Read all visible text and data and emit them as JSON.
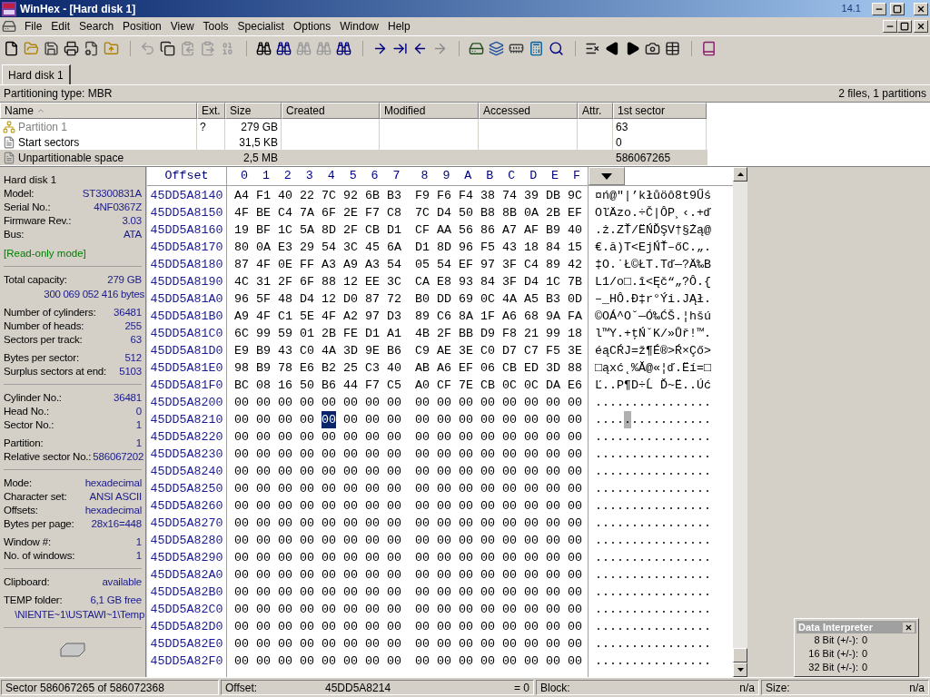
{
  "window": {
    "title": "WinHex - [Hard disk 1]",
    "version": "14.1"
  },
  "menu": [
    "File",
    "Edit",
    "Search",
    "Position",
    "View",
    "Tools",
    "Specialist",
    "Options",
    "Window",
    "Help"
  ],
  "tabs": [
    {
      "label": "Hard disk 1",
      "selected": true
    }
  ],
  "partition_bar": {
    "type": "Partitioning type: MBR",
    "summary": "2 files, 1 partitions"
  },
  "table": {
    "columns": [
      {
        "label": "Name",
        "sorted": true
      },
      {
        "label": "Ext."
      },
      {
        "label": "Size"
      },
      {
        "label": "Created"
      },
      {
        "label": "Modified"
      },
      {
        "label": "Accessed"
      },
      {
        "label": "Attr."
      },
      {
        "label": "1st sector"
      }
    ],
    "rows": [
      {
        "kind": "partition",
        "name": "Partition 1",
        "ext": "?",
        "size": "279 GB",
        "first_sector": "63",
        "selected": false
      },
      {
        "kind": "file",
        "name": "Start sectors",
        "size": "31,5 KB",
        "first_sector": "0",
        "selected": false
      },
      {
        "kind": "file",
        "name": "Unpartitionable space",
        "size": "2,5 MB",
        "first_sector": "586067265",
        "selected": true
      }
    ]
  },
  "info_panel": {
    "sections": [
      {
        "groups": [
          [
            {
              "kind": "heading",
              "label": "Hard disk 1"
            },
            {
              "kind": "pair",
              "label": "Model:",
              "value": "ST3300831A"
            },
            {
              "kind": "pair",
              "label": "Serial No.:",
              "value": "4NF0367Z"
            },
            {
              "kind": "pair",
              "label": "Firmware Rev.:",
              "value": "3.03"
            },
            {
              "kind": "pair",
              "label": "Bus:",
              "value": "ATA"
            }
          ],
          [
            {
              "kind": "note",
              "label": "[Read-only mode]"
            }
          ]
        ]
      },
      {
        "groups": [
          [
            {
              "kind": "pair",
              "label": "Total capacity:",
              "value": "279 GB"
            },
            {
              "kind": "value",
              "value": "300 069 052 416 bytes"
            }
          ],
          [
            {
              "kind": "pair",
              "label": "Number of cylinders:",
              "value": "36481"
            },
            {
              "kind": "pair",
              "label": "Number of heads:",
              "value": "255"
            },
            {
              "kind": "pair",
              "label": "Sectors per track:",
              "value": "63"
            }
          ],
          [
            {
              "kind": "pair",
              "label": "Bytes per sector:",
              "value": "512"
            },
            {
              "kind": "pair",
              "label": "Surplus sectors at end:",
              "value": "5103"
            }
          ]
        ]
      },
      {
        "groups": [
          [
            {
              "kind": "pair",
              "label": "Cylinder No.:",
              "value": "36481"
            },
            {
              "kind": "pair",
              "label": "Head No.:",
              "value": "0"
            },
            {
              "kind": "pair",
              "label": "Sector No.:",
              "value": "1"
            }
          ],
          [
            {
              "kind": "pair",
              "label": "Partition:",
              "value": "1"
            },
            {
              "kind": "pair",
              "label": "Relative sector No.:",
              "value": "586067202"
            }
          ]
        ]
      },
      {
        "groups": [
          [
            {
              "kind": "pair",
              "label": "Mode:",
              "value": "hexadecimal"
            },
            {
              "kind": "pair",
              "label": "Character set:",
              "value": "ANSI ASCII"
            },
            {
              "kind": "pair",
              "label": "Offsets:",
              "value": "hexadecimal"
            },
            {
              "kind": "pair",
              "label": "Bytes per page:",
              "value": "28x16=448"
            }
          ],
          [
            {
              "kind": "pair",
              "label": "Window #:",
              "value": "1"
            },
            {
              "kind": "pair",
              "label": "No. of windows:",
              "value": "1"
            }
          ]
        ]
      },
      {
        "groups": [
          [
            {
              "kind": "pair",
              "label": "Clipboard:",
              "value": "available"
            }
          ],
          [
            {
              "kind": "pair",
              "label": "TEMP folder:",
              "value": "6,1 GB free"
            },
            {
              "kind": "value",
              "value": "\\NIENTE~1\\USTAWI~1\\Temp"
            }
          ]
        ]
      }
    ]
  },
  "hex": {
    "offset_header": "Offset",
    "columns": [
      "0",
      "1",
      "2",
      "3",
      "4",
      "5",
      "6",
      "7",
      "8",
      "9",
      "A",
      "B",
      "C",
      "D",
      "E",
      "F"
    ],
    "rows": [
      {
        "offset": "45DD5A8140",
        "left": [
          {
            "text": "A4 F1 40 22 7C 92 6B B3",
            "selected": false
          }
        ],
        "right": [
          {
            "text": "F9 F6 F4 38 74 39 DB 9C",
            "selected": false
          }
        ],
        "text": [
          {
            "text": "¤ń@\"|’kłůöô8t9Űś",
            "selected": false
          }
        ]
      },
      {
        "offset": "45DD5A8150",
        "left": [
          {
            "text": "4F BE C4 7A 6F 2E F7 C8",
            "selected": false
          }
        ],
        "right": [
          {
            "text": "7C D4 50 B8 8B 0A 2B EF",
            "selected": false
          }
        ],
        "text": [
          {
            "text": "OľÄzo.÷Č|ÔP¸‹.+ď",
            "selected": false
          }
        ]
      },
      {
        "offset": "45DD5A8160",
        "left": [
          {
            "text": "19 BF 1C 5A 8D 2F CB D1",
            "selected": false
          }
        ],
        "right": [
          {
            "text": "CF AA 56 86 A7 AF B9 40",
            "selected": false
          }
        ],
        "text": [
          {
            "text": ".ż.ZŤ/ËŃĎŞV†§Żą@",
            "selected": false
          }
        ]
      },
      {
        "offset": "45DD5A8170",
        "left": [
          {
            "text": "80 0A E3 29 54 3C 45 6A",
            "selected": false
          }
        ],
        "right": [
          {
            "text": "D1 8D 96 F5 43 18 84 15",
            "selected": false
          }
        ],
        "text": [
          {
            "text": "€.ă)T<EjŃŤ–őC.„.",
            "selected": false
          }
        ]
      },
      {
        "offset": "45DD5A8180",
        "left": [
          {
            "text": "87 4F 0E FF A3 A9 A3 54",
            "selected": false
          }
        ],
        "right": [
          {
            "text": "05 54 EF 97 3F C4 89 42",
            "selected": false
          }
        ],
        "text": [
          {
            "text": "‡O.˙Ł©ŁT.Tď—?Ä‰B",
            "selected": false
          }
        ]
      },
      {
        "offset": "45DD5A8190",
        "left": [
          {
            "text": "4C 31 2F 6F 88 12 EE 3C",
            "selected": false
          }
        ],
        "right": [
          {
            "text": "CA E8 93 84 3F D4 1C 7B",
            "selected": false
          }
        ],
        "text": [
          {
            "text": "L1/o□.î<Ęč“„?Ô.{",
            "selected": false
          }
        ]
      },
      {
        "offset": "45DD5A81A0",
        "left": [
          {
            "text": "96 5F 48 D4 12 D0 87 72",
            "selected": false
          }
        ],
        "right": [
          {
            "text": "B0 DD 69 0C 4A A5 B3 0D",
            "selected": false
          }
        ],
        "text": [
          {
            "text": "–_HÔ.Đ‡r°Ýi.JĄł.",
            "selected": false
          }
        ]
      },
      {
        "offset": "45DD5A81B0",
        "left": [
          {
            "text": "A9 4F C1 5E 4F A2 97 D3",
            "selected": false
          }
        ],
        "right": [
          {
            "text": "89 C6 8A 1F A6 68 9A FA",
            "selected": false
          }
        ],
        "text": [
          {
            "text": "©OÁ^O˘—Ó‰ĆŠ.¦hšú",
            "selected": false
          }
        ]
      },
      {
        "offset": "45DD5A81C0",
        "left": [
          {
            "text": "6C 99 59 01 2B FE D1 A1",
            "selected": false
          }
        ],
        "right": [
          {
            "text": "4B 2F BB D9 F8 21 99 18",
            "selected": false
          }
        ],
        "text": [
          {
            "text": "l™Y.+ţŃˇK/»Ůř!™.",
            "selected": false
          }
        ]
      },
      {
        "offset": "45DD5A81D0",
        "left": [
          {
            "text": "E9 B9 43 C0 4A 3D 9E B6",
            "selected": false
          }
        ],
        "right": [
          {
            "text": "C9 AE 3E C0 D7 C7 F5 3E",
            "selected": false
          }
        ],
        "text": [
          {
            "text": "éąCŔJ=ž¶É®>Ŕ×Çő>",
            "selected": false
          }
        ]
      },
      {
        "offset": "45DD5A81E0",
        "left": [
          {
            "text": "98 B9 78 E6 B2 25 C3 40",
            "selected": false
          }
        ],
        "right": [
          {
            "text": "AB A6 EF 06 CB ED 3D 88",
            "selected": false
          }
        ],
        "text": [
          {
            "text": "□ąxć˛%Ă@«¦ď.Ëí=□",
            "selected": false
          }
        ]
      },
      {
        "offset": "45DD5A81F0",
        "left": [
          {
            "text": "BC 08 16 50 B6 44 F7 C5",
            "selected": false
          }
        ],
        "right": [
          {
            "text": "A0 CF 7E CB 0C 0C DA E6",
            "selected": false
          }
        ],
        "text": [
          {
            "text": "Ľ..P¶D÷Ĺ Ď~Ë..Úć",
            "selected": false
          }
        ]
      },
      {
        "offset": "45DD5A8200",
        "left": [
          {
            "text": "00 00 00 00 00 00 00 00",
            "selected": false
          }
        ],
        "right": [
          {
            "text": "00 00 00 00 00 00 00 00",
            "selected": false
          }
        ],
        "text": [
          {
            "text": "................",
            "selected": false
          }
        ]
      },
      {
        "offset": "45DD5A8210",
        "left": [
          {
            "text": "00 00 00 00",
            "selected": false
          },
          {
            "text": "00",
            "selected": true
          },
          {
            "text": "00 00 00",
            "selected": false
          }
        ],
        "right": [
          {
            "text": "00 00 00 00 00 00 00 00",
            "selected": false
          }
        ],
        "text": [
          {
            "text": "....",
            "selected": false
          },
          {
            "text": ".",
            "selected": true
          },
          {
            "text": "...........",
            "selected": false
          }
        ]
      },
      {
        "offset": "45DD5A8220",
        "left": [
          {
            "text": "00 00 00 00 00 00 00 00",
            "selected": false
          }
        ],
        "right": [
          {
            "text": "00 00 00 00 00 00 00 00",
            "selected": false
          }
        ],
        "text": [
          {
            "text": "................",
            "selected": false
          }
        ]
      },
      {
        "offset": "45DD5A8230",
        "left": [
          {
            "text": "00 00 00 00 00 00 00 00",
            "selected": false
          }
        ],
        "right": [
          {
            "text": "00 00 00 00 00 00 00 00",
            "selected": false
          }
        ],
        "text": [
          {
            "text": "................",
            "selected": false
          }
        ]
      },
      {
        "offset": "45DD5A8240",
        "left": [
          {
            "text": "00 00 00 00 00 00 00 00",
            "selected": false
          }
        ],
        "right": [
          {
            "text": "00 00 00 00 00 00 00 00",
            "selected": false
          }
        ],
        "text": [
          {
            "text": "................",
            "selected": false
          }
        ]
      },
      {
        "offset": "45DD5A8250",
        "left": [
          {
            "text": "00 00 00 00 00 00 00 00",
            "selected": false
          }
        ],
        "right": [
          {
            "text": "00 00 00 00 00 00 00 00",
            "selected": false
          }
        ],
        "text": [
          {
            "text": "................",
            "selected": false
          }
        ]
      },
      {
        "offset": "45DD5A8260",
        "left": [
          {
            "text": "00 00 00 00 00 00 00 00",
            "selected": false
          }
        ],
        "right": [
          {
            "text": "00 00 00 00 00 00 00 00",
            "selected": false
          }
        ],
        "text": [
          {
            "text": "................",
            "selected": false
          }
        ]
      },
      {
        "offset": "45DD5A8270",
        "left": [
          {
            "text": "00 00 00 00 00 00 00 00",
            "selected": false
          }
        ],
        "right": [
          {
            "text": "00 00 00 00 00 00 00 00",
            "selected": false
          }
        ],
        "text": [
          {
            "text": "................",
            "selected": false
          }
        ]
      },
      {
        "offset": "45DD5A8280",
        "left": [
          {
            "text": "00 00 00 00 00 00 00 00",
            "selected": false
          }
        ],
        "right": [
          {
            "text": "00 00 00 00 00 00 00 00",
            "selected": false
          }
        ],
        "text": [
          {
            "text": "................",
            "selected": false
          }
        ]
      },
      {
        "offset": "45DD5A8290",
        "left": [
          {
            "text": "00 00 00 00 00 00 00 00",
            "selected": false
          }
        ],
        "right": [
          {
            "text": "00 00 00 00 00 00 00 00",
            "selected": false
          }
        ],
        "text": [
          {
            "text": "................",
            "selected": false
          }
        ]
      },
      {
        "offset": "45DD5A82A0",
        "left": [
          {
            "text": "00 00 00 00 00 00 00 00",
            "selected": false
          }
        ],
        "right": [
          {
            "text": "00 00 00 00 00 00 00 00",
            "selected": false
          }
        ],
        "text": [
          {
            "text": "................",
            "selected": false
          }
        ]
      },
      {
        "offset": "45DD5A82B0",
        "left": [
          {
            "text": "00 00 00 00 00 00 00 00",
            "selected": false
          }
        ],
        "right": [
          {
            "text": "00 00 00 00 00 00 00 00",
            "selected": false
          }
        ],
        "text": [
          {
            "text": "................",
            "selected": false
          }
        ]
      },
      {
        "offset": "45DD5A82C0",
        "left": [
          {
            "text": "00 00 00 00 00 00 00 00",
            "selected": false
          }
        ],
        "right": [
          {
            "text": "00 00 00 00 00 00 00 00",
            "selected": false
          }
        ],
        "text": [
          {
            "text": "................",
            "selected": false
          }
        ]
      },
      {
        "offset": "45DD5A82D0",
        "left": [
          {
            "text": "00 00 00 00 00 00 00 00",
            "selected": false
          }
        ],
        "right": [
          {
            "text": "00 00 00 00 00 00 00 00",
            "selected": false
          }
        ],
        "text": [
          {
            "text": "................",
            "selected": false
          }
        ]
      },
      {
        "offset": "45DD5A82E0",
        "left": [
          {
            "text": "00 00 00 00 00 00 00 00",
            "selected": false
          }
        ],
        "right": [
          {
            "text": "00 00 00 00 00 00 00 00",
            "selected": false
          }
        ],
        "text": [
          {
            "text": "................",
            "selected": false
          }
        ]
      },
      {
        "offset": "45DD5A82F0",
        "left": [
          {
            "text": "00 00 00 00 00 00 00 00",
            "selected": false
          }
        ],
        "right": [
          {
            "text": "00 00 00 00 00 00 00 00",
            "selected": false
          }
        ],
        "text": [
          {
            "text": "................",
            "selected": false
          }
        ]
      }
    ]
  },
  "data_interpreter": {
    "title": "Data Interpreter",
    "rows": [
      {
        "label": "8 Bit (+/-):",
        "value": "0"
      },
      {
        "label": "16 Bit (+/-):",
        "value": "0"
      },
      {
        "label": "32 Bit (+/-):",
        "value": "0"
      }
    ]
  },
  "status_bar": {
    "sector": "Sector 586067265 of 586072368",
    "offset_label": "Offset:",
    "offset": "45DD5A8214",
    "value": "= 0",
    "block_label": "Block:",
    "block": "n/a",
    "size_label": "Size:",
    "size": "n/a"
  }
}
